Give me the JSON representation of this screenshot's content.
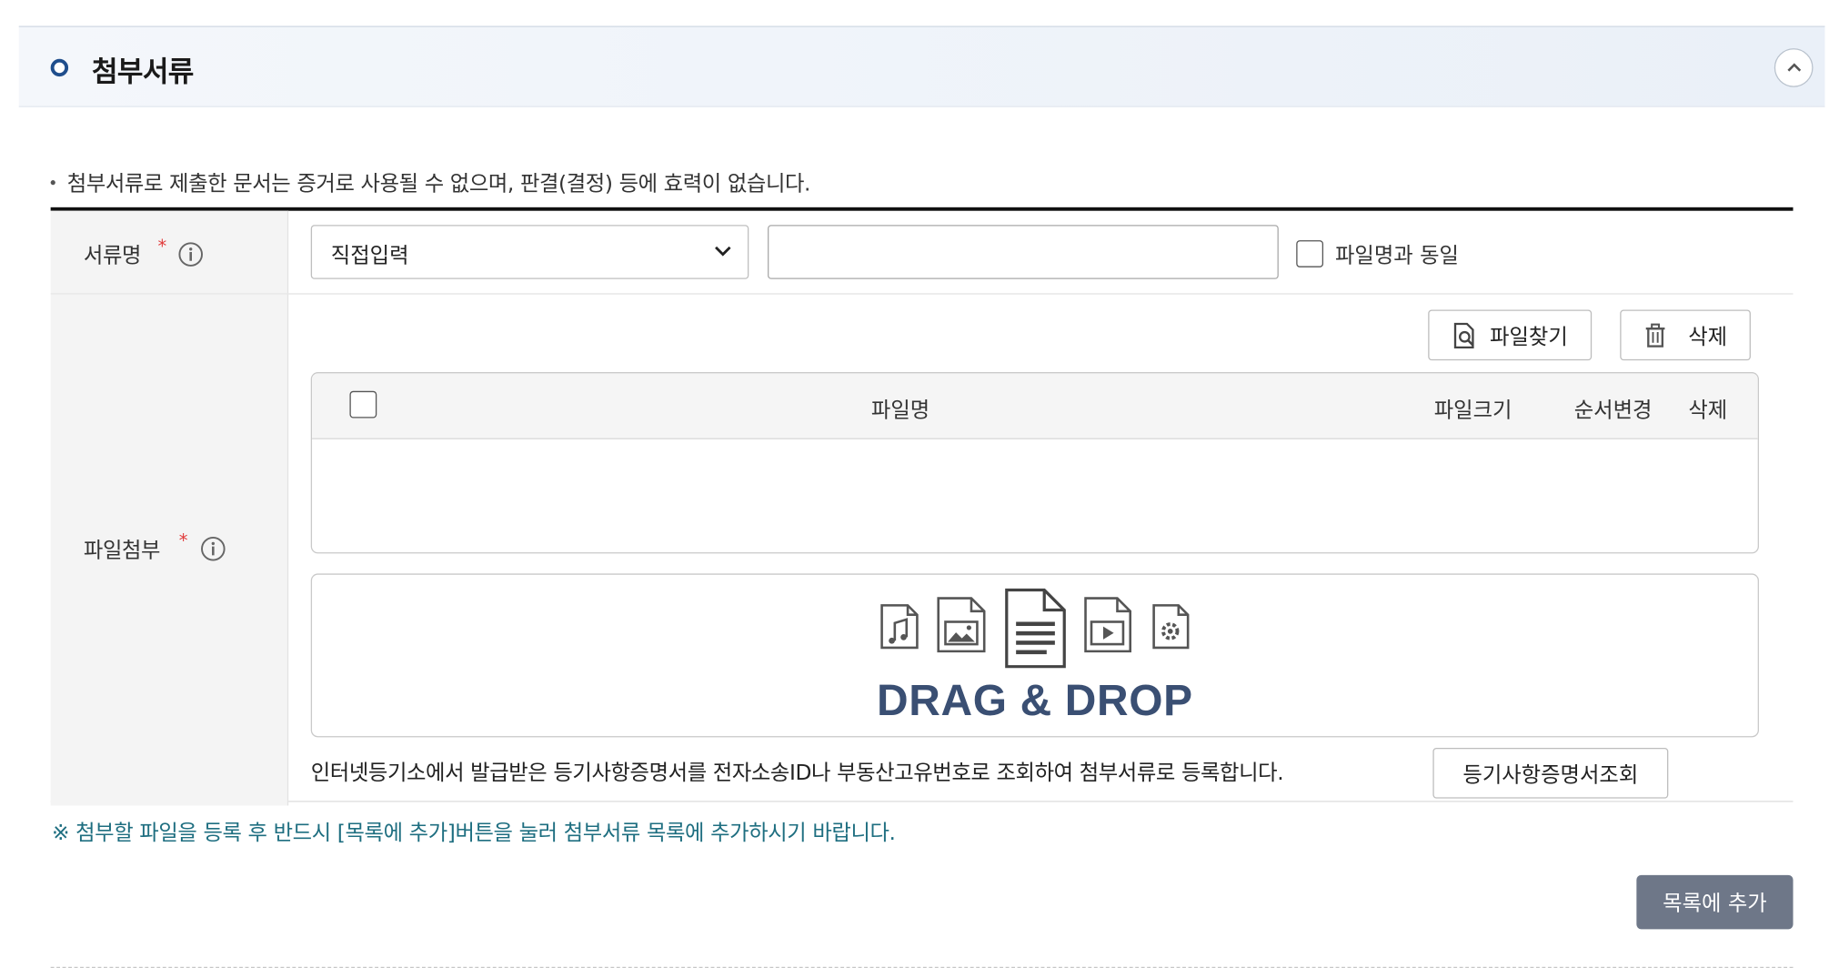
{
  "section": {
    "title": "첨부서류"
  },
  "notice": "첨부서류로 제출한 문서는 증거로 사용될 수 없으며, 판결(결정) 등에 효력이 없습니다.",
  "form": {
    "doc_name_label": "서류명",
    "required_mark": "*",
    "doc_type_select": {
      "selected": "직접입력"
    },
    "doc_name_input": {
      "value": ""
    },
    "same_as_filename_label": "파일명과 동일",
    "file_attach_label": "파일첨부",
    "find_file_label": "파일찾기",
    "delete_label": "삭제",
    "file_table": {
      "headers": [
        "파일명",
        "파일크기",
        "순서변경",
        "삭제"
      ]
    },
    "drop_zone_text": "DRAG & DROP",
    "registry_text": "인터넷등기소에서 발급받은 등기사항증명서를 전자소송ID나 부동산고유번호로 조회하여 첨부서류로 등록합니다.",
    "registry_button_label": "등기사항증명서조회"
  },
  "warning": "※ 첨부할 파일을 등록 후 반드시 [목록에 추가]버튼을 눌러 첨부서류 목록에 추가하시기 바랍니다.",
  "add_to_list_label": "목록에 추가",
  "colors": {
    "accent": "#1f4e8c",
    "required": "#e13a3a",
    "warning_text": "#1e6e80",
    "primary_button": "#6e7788",
    "drop_text": "#3a4f73"
  },
  "icons": [
    "collapse-chevron-up-icon",
    "info-icon",
    "chevron-down-icon",
    "file-search-icon",
    "trash-icon",
    "audio-file-icon",
    "image-file-icon",
    "document-file-icon",
    "video-file-icon",
    "settings-file-icon"
  ]
}
